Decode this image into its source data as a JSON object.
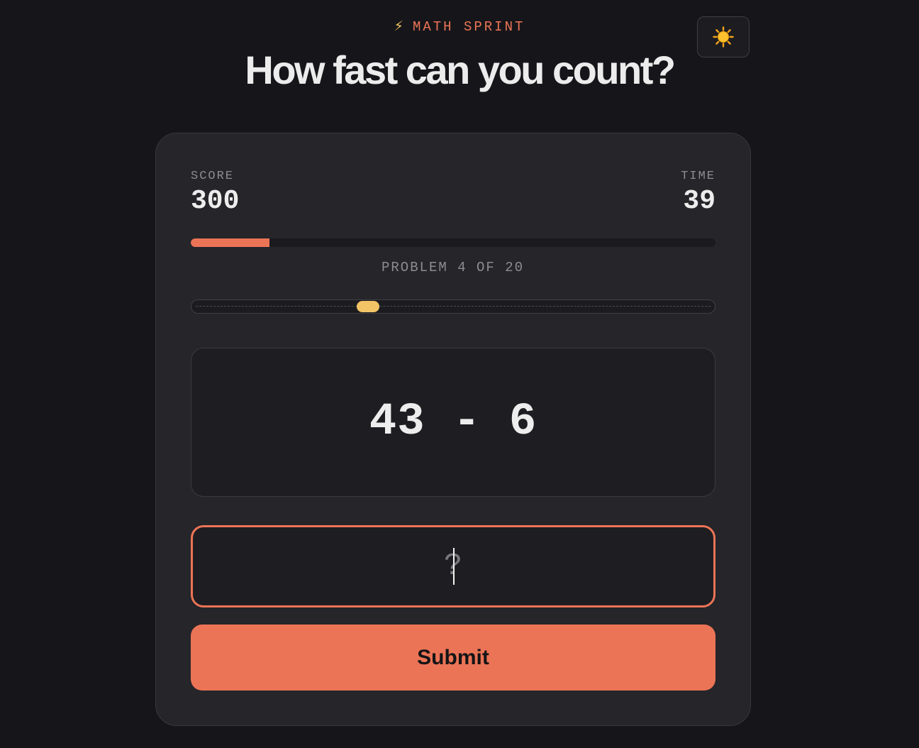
{
  "header": {
    "bolt_icon": "lightning-bolt-icon",
    "bolt_glyph": "⚡",
    "brand": "MATH SPRINT",
    "title": "How fast can you count?",
    "theme_toggle_icon": "sun-icon"
  },
  "stats": {
    "score_label": "SCORE",
    "score_value": "300",
    "time_label": "TIME",
    "time_value": "39"
  },
  "progress": {
    "current": 4,
    "total": 20,
    "fraction": 0.15,
    "label": "PROBLEM 4 OF 20"
  },
  "timer_slider": {
    "fraction": 0.337
  },
  "problem": {
    "expression": "43 - 6"
  },
  "answer": {
    "value": "",
    "placeholder": "?"
  },
  "submit": {
    "label": "Submit"
  },
  "colors": {
    "accent": "#ec7456",
    "highlight": "#f3c465",
    "background": "#16161a",
    "card": "#25252a"
  }
}
